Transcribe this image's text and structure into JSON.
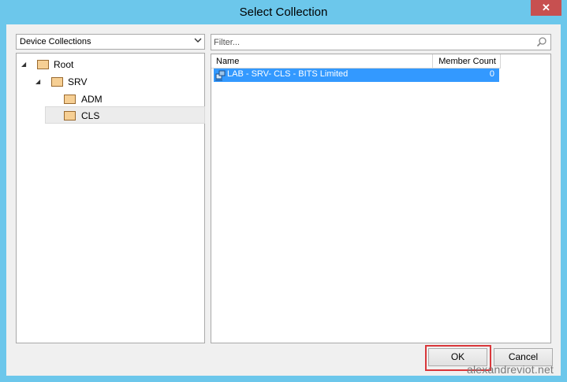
{
  "window": {
    "title": "Select Collection",
    "close_glyph": "✕"
  },
  "left": {
    "combo": {
      "value": "Device Collections",
      "arrow_icon": "chevron-down-icon"
    },
    "tree": {
      "root": {
        "label": "Root",
        "expand": "◢"
      },
      "srv": {
        "label": "SRV",
        "expand": "◢"
      },
      "adm": {
        "label": "ADM"
      },
      "cls": {
        "label": "CLS"
      }
    }
  },
  "right": {
    "filter": {
      "placeholder": "Filter...",
      "icon": "search-icon"
    },
    "grid": {
      "columns": [
        "Name",
        "Member Count"
      ],
      "rows": [
        {
          "name": "LAB - SRV- CLS - BITS Limited",
          "member_count": "0",
          "selected": true
        }
      ]
    }
  },
  "buttons": {
    "ok": "OK",
    "cancel": "Cancel"
  },
  "watermark": "alexandreviot.net",
  "colors": {
    "titlebar": "#6cc7eb",
    "selection": "#3399ff",
    "close": "#c75050",
    "highlight": "#d9373a"
  }
}
